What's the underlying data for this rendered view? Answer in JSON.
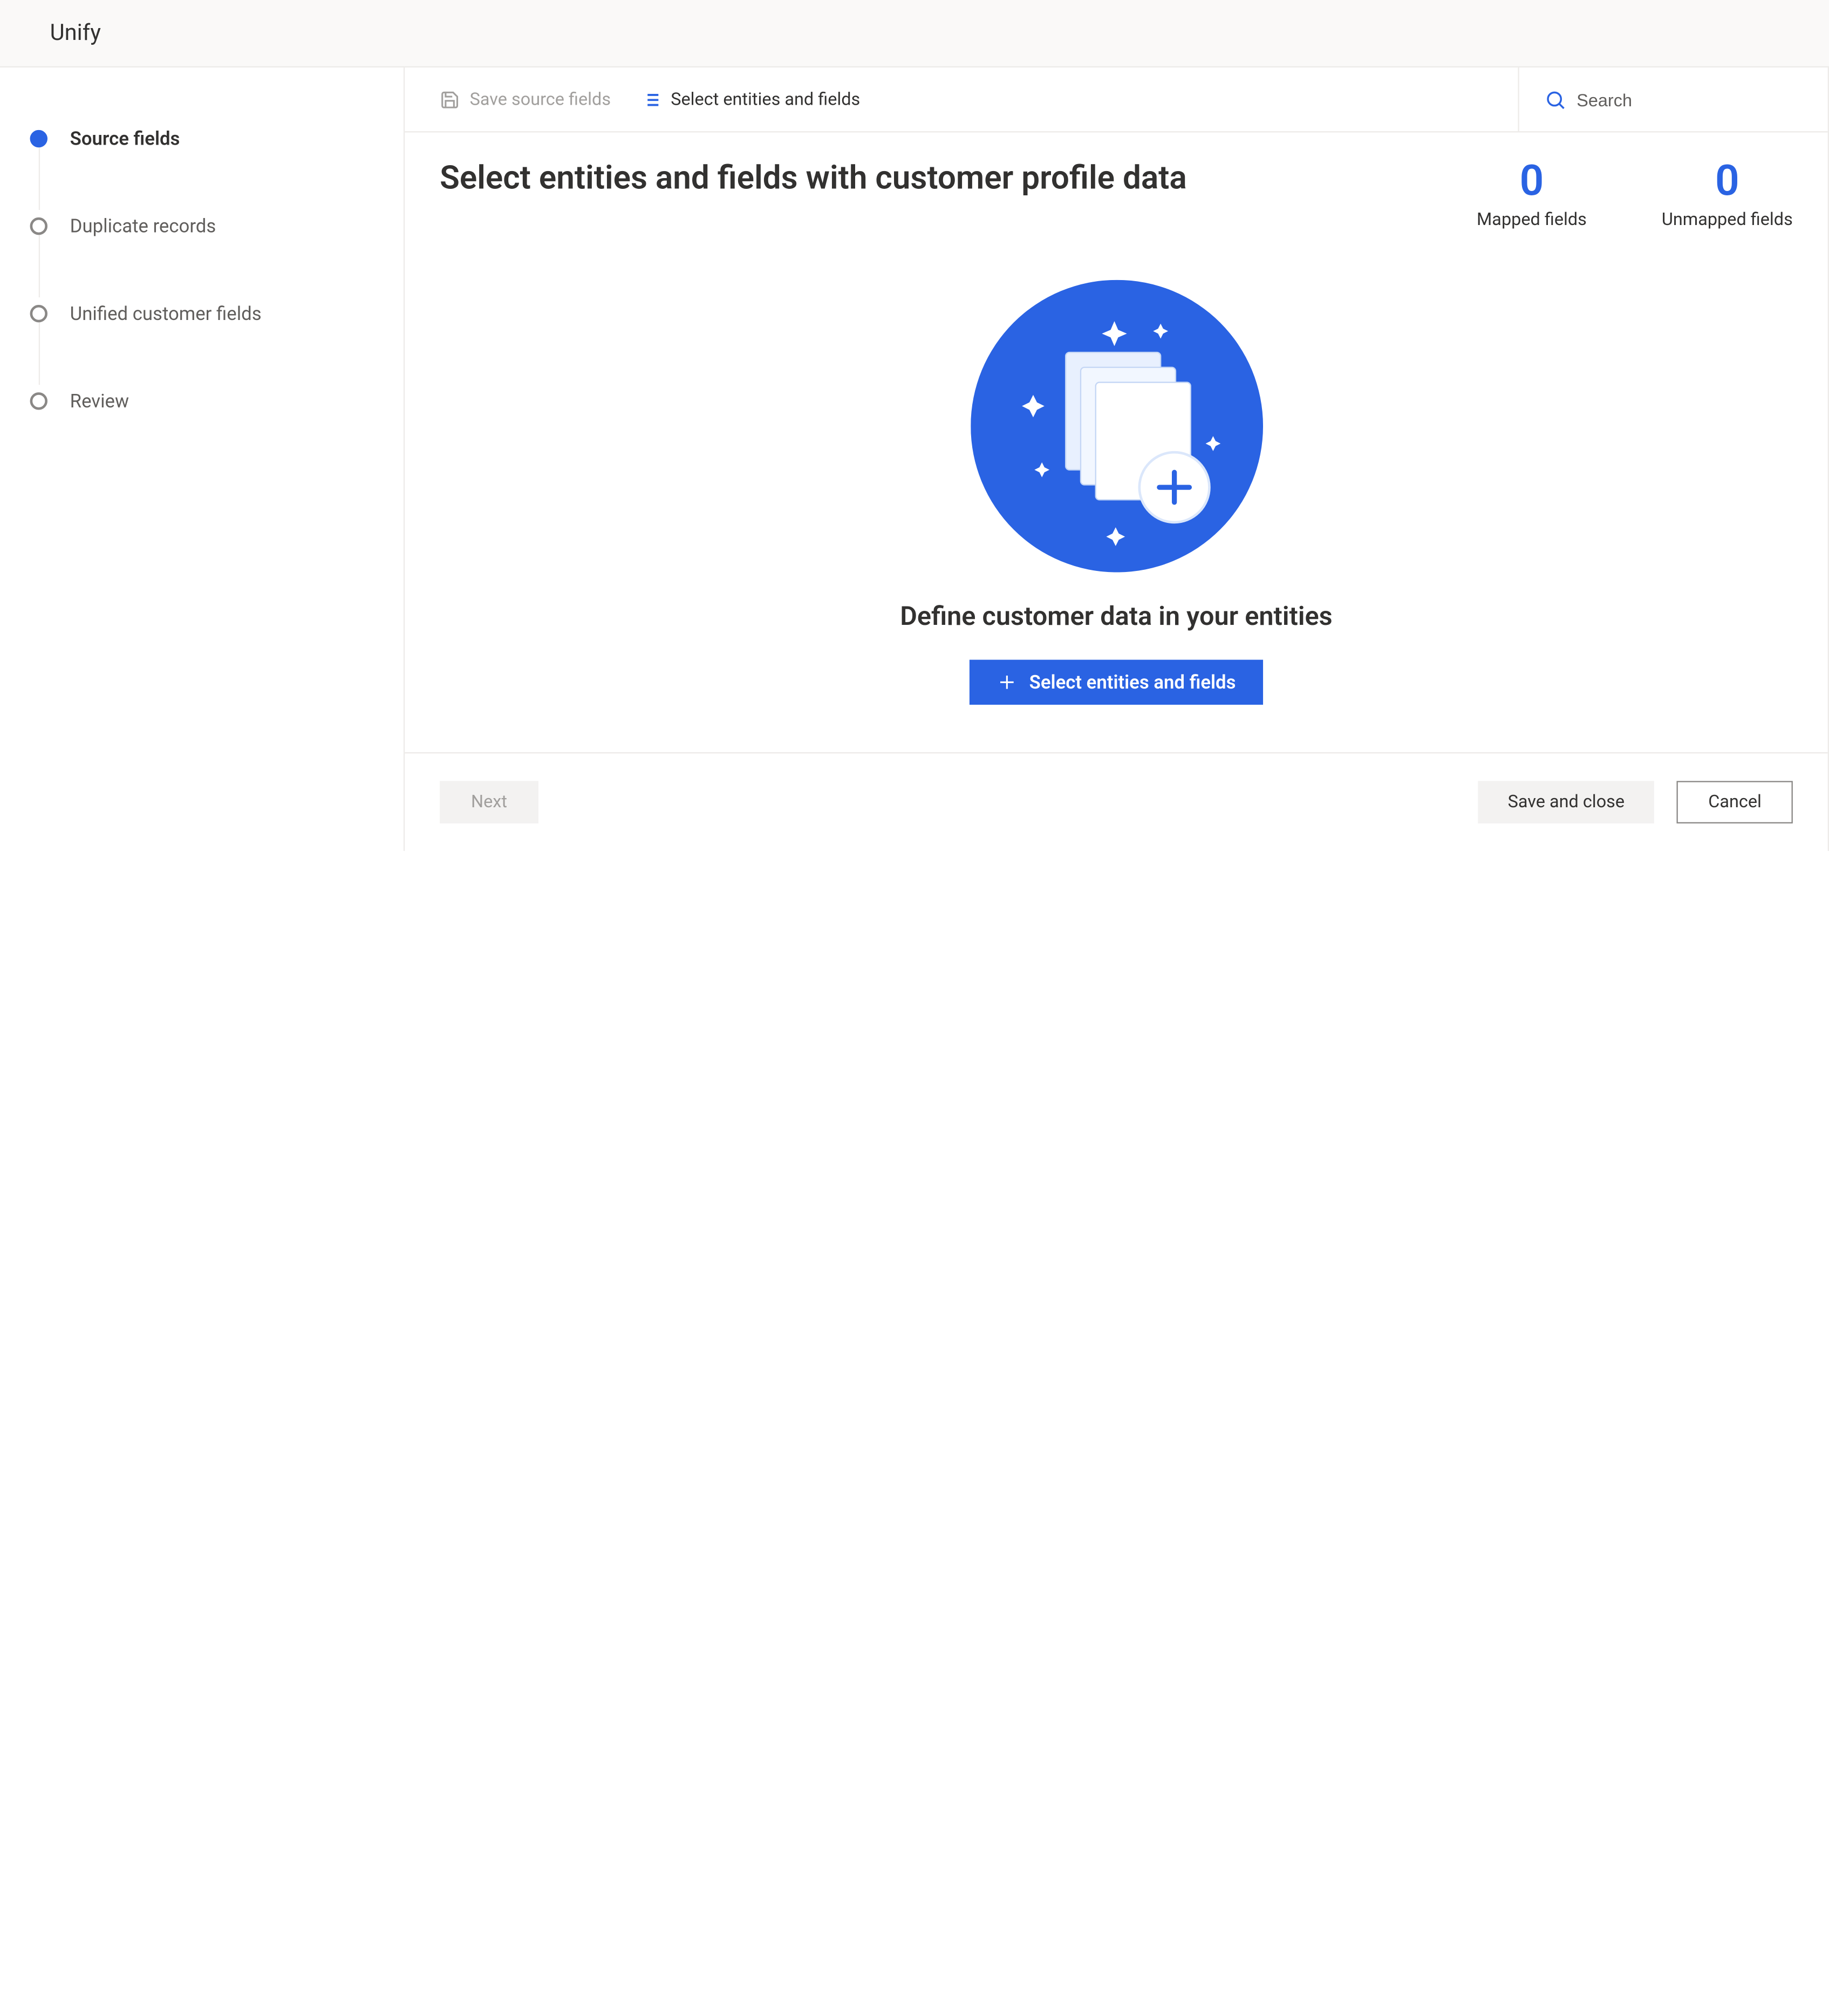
{
  "header": {
    "title": "Unify"
  },
  "sidebar": {
    "steps": [
      {
        "label": "Source fields",
        "active": true
      },
      {
        "label": "Duplicate records",
        "active": false
      },
      {
        "label": "Unified customer fields",
        "active": false
      },
      {
        "label": "Review",
        "active": false
      }
    ]
  },
  "toolbar": {
    "save_label": "Save source fields",
    "select_label": "Select entities and fields",
    "search_placeholder": "Search"
  },
  "main": {
    "heading": "Select entities and fields with customer profile data",
    "stats": {
      "mapped": {
        "value": "0",
        "label": "Mapped fields"
      },
      "unmapped": {
        "value": "0",
        "label": "Unmapped fields"
      }
    },
    "empty": {
      "heading": "Define customer data in your entities",
      "cta_label": "Select entities and fields"
    }
  },
  "footer": {
    "next": "Next",
    "save_close": "Save and close",
    "cancel": "Cancel"
  },
  "colors": {
    "accent": "#2a63e3"
  }
}
